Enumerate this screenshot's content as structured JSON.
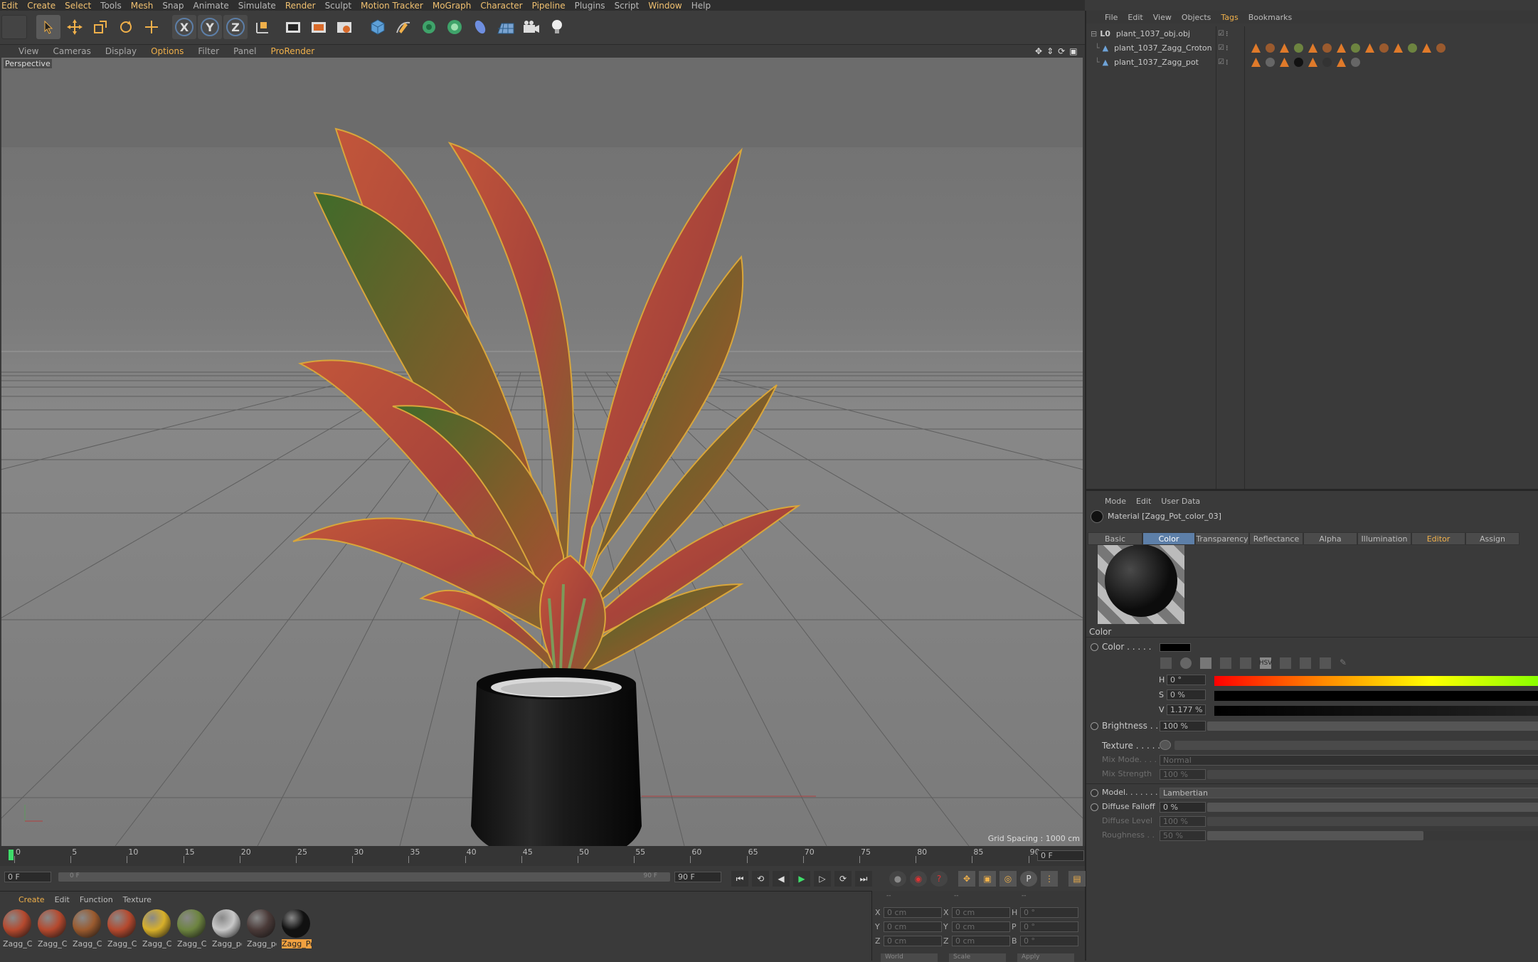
{
  "menubar": [
    "Edit",
    "Create",
    "Select",
    "Tools",
    "Mesh",
    "Snap",
    "Animate",
    "Simulate",
    "Render",
    "Sculpt",
    "Motion Tracker",
    "MoGraph",
    "Character",
    "Pipeline",
    "Plugins",
    "Script",
    "Window",
    "Help"
  ],
  "viewport_menu": {
    "items": [
      "View",
      "Cameras",
      "Display",
      "Options",
      "Filter",
      "Panel",
      "ProRender"
    ],
    "highlighted": [
      "Options",
      "ProRender"
    ],
    "label": "Perspective",
    "grid_spacing": "Grid Spacing : 1000 cm"
  },
  "toolbar": {
    "axes": [
      "X",
      "Y",
      "Z"
    ]
  },
  "object_manager": {
    "menu": [
      "File",
      "Edit",
      "View",
      "Objects",
      "Tags",
      "Bookmarks"
    ],
    "highlighted": "Tags",
    "objects": [
      {
        "name": "plant_1037_obj.obj",
        "prefix": "L0"
      },
      {
        "name": "plant_1037_Zagg_Croton"
      },
      {
        "name": "plant_1037_Zagg_pot"
      }
    ]
  },
  "attributes": {
    "menu": [
      "Mode",
      "Edit",
      "User Data"
    ],
    "title": "Material [Zagg_Pot_color_03]",
    "tabs": [
      "Basic",
      "Color",
      "Transparency",
      "Reflectance",
      "Alpha",
      "Illumination",
      "Editor",
      "Assign"
    ],
    "active_tab": "Color",
    "highlight_tab": "Editor",
    "section": "Color",
    "color_label": "Color . . . . .",
    "h_label": "H",
    "h_value": "0 °",
    "s_label": "S",
    "s_value": "0 %",
    "v_label": "V",
    "v_value": "1.177 %",
    "brightness_label": "Brightness . . .",
    "brightness_value": "100 %",
    "texture_label": "Texture . . . . . .",
    "mixmode_label": "Mix Mode. . . .",
    "mixmode_value": "Normal",
    "mixstrength_label": "Mix Strength",
    "mixstrength_value": "100 %",
    "model_label": "Model. . . . . . .",
    "model_value": "Lambertian",
    "diffusefalloff_label": "Diffuse Falloff",
    "diffusefalloff_value": "0 %",
    "diffuselevel_label": "Diffuse Level",
    "diffuselevel_value": "100 %",
    "roughness_label": "Roughness . .",
    "roughness_value": "50 %",
    "hsv_icon_label": "HSV"
  },
  "timeline": {
    "ticks": [
      "0",
      "5",
      "10",
      "15",
      "20",
      "25",
      "30",
      "35",
      "40",
      "45",
      "50",
      "55",
      "60",
      "65",
      "70",
      "75",
      "80",
      "85",
      "90"
    ],
    "frame_display": "0 F"
  },
  "transport": {
    "current_frame": "0 F",
    "range_start": "0 F",
    "range_end": "90 F",
    "end_frame": "90 F"
  },
  "material_manager": {
    "menu": [
      "Create",
      "Edit",
      "Function",
      "Texture"
    ],
    "materials": [
      {
        "label": "Zagg_Cr",
        "color": "#b5492e"
      },
      {
        "label": "Zagg_Cr",
        "color": "#b5492e"
      },
      {
        "label": "Zagg_Cr",
        "color": "#9a5a2e"
      },
      {
        "label": "Zagg_Cr",
        "color": "#b5492e"
      },
      {
        "label": "Zagg_Cr",
        "color": "#d8b02a"
      },
      {
        "label": "Zagg_Cr",
        "color": "#6d8440"
      },
      {
        "label": "Zagg_po",
        "color": "#c8c8c8"
      },
      {
        "label": "Zagg_po",
        "color": "#4a3a38"
      },
      {
        "label": "Zagg_Po",
        "color": "#111111",
        "selected": true
      }
    ]
  },
  "coordinates": {
    "header": [
      "--",
      "--",
      "--"
    ],
    "rows": [
      {
        "a": "X",
        "av": "0 cm",
        "b": "X",
        "bv": "0 cm",
        "c": "H",
        "cv": "0 °"
      },
      {
        "a": "Y",
        "av": "0 cm",
        "b": "Y",
        "bv": "0 cm",
        "c": "P",
        "cv": "0 °"
      },
      {
        "a": "Z",
        "av": "0 cm",
        "b": "Z",
        "bv": "0 cm",
        "c": "B",
        "cv": "0 °"
      }
    ],
    "footer": [
      "World",
      "Scale",
      "Apply"
    ]
  },
  "colors": {
    "accent": "#f0b04a",
    "tab_active": "#5d7fa8",
    "selected_material": "#f0a040"
  }
}
